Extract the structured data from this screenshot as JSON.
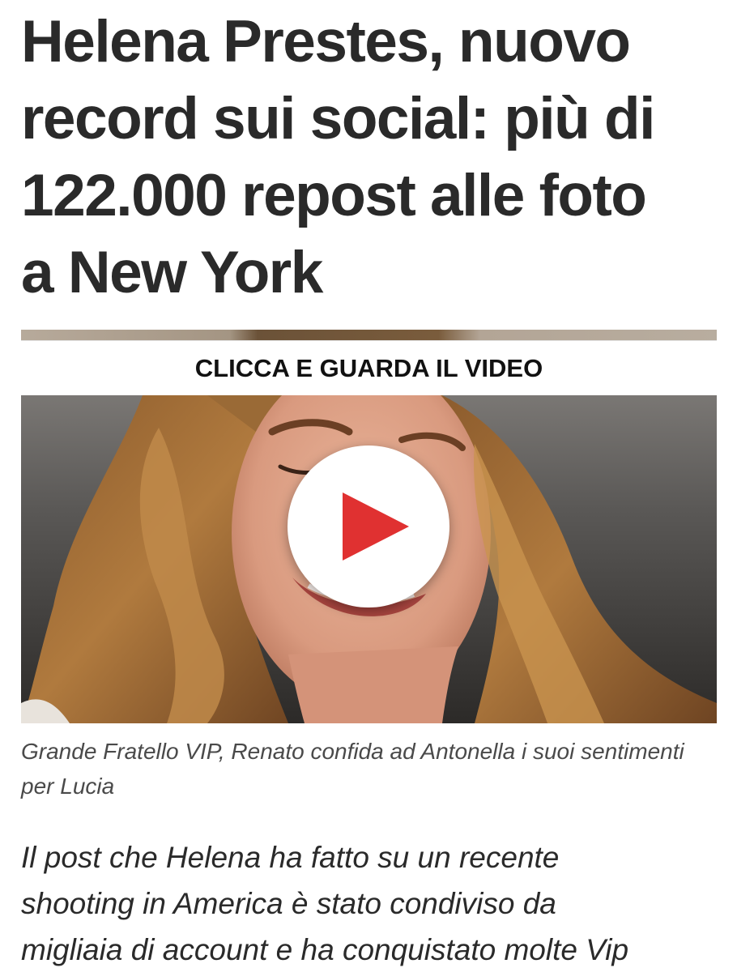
{
  "article": {
    "headline_lines": [
      "Helena Prestes, nuovo",
      "record sui social: più di",
      "122.000 repost alle foto",
      "a New York"
    ],
    "video_label": "CLICCA E GUARDA IL VIDEO",
    "video_caption": "Grande Fratello VIP, Renato confida ad Antonella i suoi sentimenti per Lucia",
    "lead_lines": [
      "Il post che Helena ha fatto su un recente",
      "shooting in America è stato condiviso da",
      "migliaia di account e ha conquistato molte Vip"
    ]
  },
  "icons": {
    "play": "play-icon"
  },
  "colors": {
    "play_red": "#e03131",
    "headline": "#2a2a2a",
    "caption": "#4a4a4a"
  }
}
